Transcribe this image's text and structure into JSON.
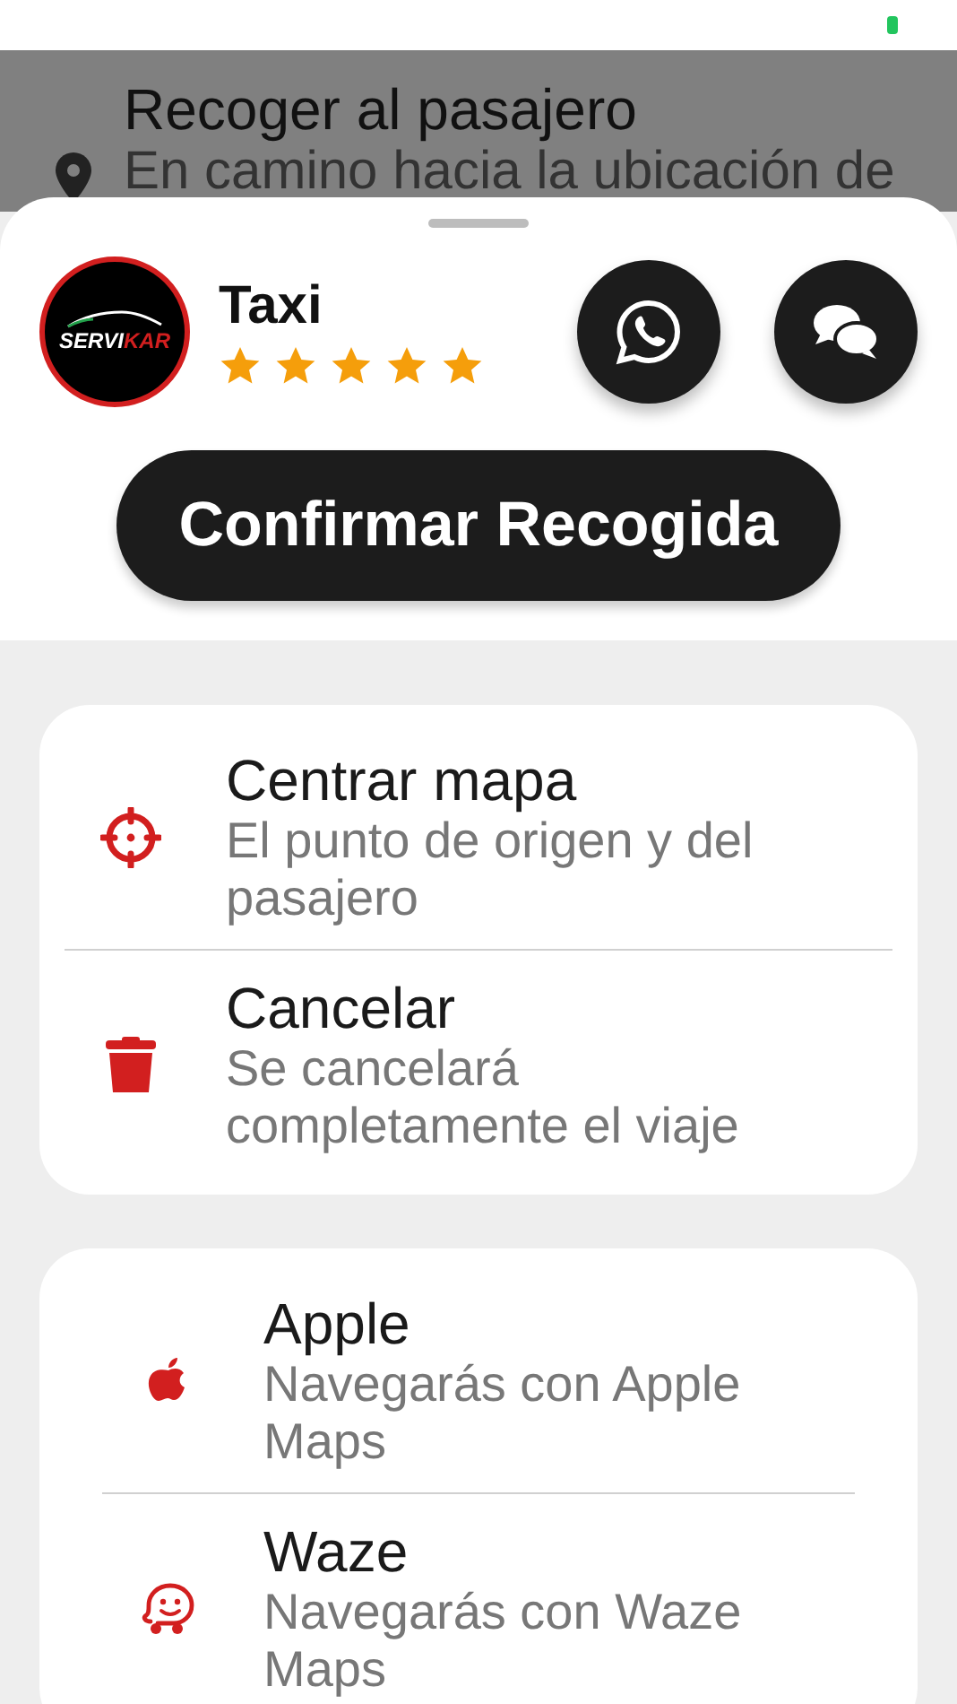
{
  "background": {
    "title": "Recoger al pasajero",
    "subtitle": "En camino hacia la ubicación de"
  },
  "driver": {
    "logo_parts": [
      "SERVI",
      "KAR"
    ],
    "name": "Taxi",
    "stars": 5
  },
  "contact_buttons": [
    {
      "kind": "whatsapp"
    },
    {
      "kind": "chat"
    }
  ],
  "confirm_button": "Confirmar Recogida",
  "actions": [
    {
      "kind": "center",
      "title": "Centrar mapa",
      "subtitle": "El punto de origen y del pasajero"
    },
    {
      "kind": "cancel",
      "title": "Cancelar",
      "subtitle": "Se cancelará completamente el viaje"
    }
  ],
  "navigation": [
    {
      "kind": "apple",
      "title": "Apple",
      "subtitle": "Navegarás con Apple Maps"
    },
    {
      "kind": "waze",
      "title": "Waze",
      "subtitle": "Navegarás con Waze Maps"
    }
  ]
}
